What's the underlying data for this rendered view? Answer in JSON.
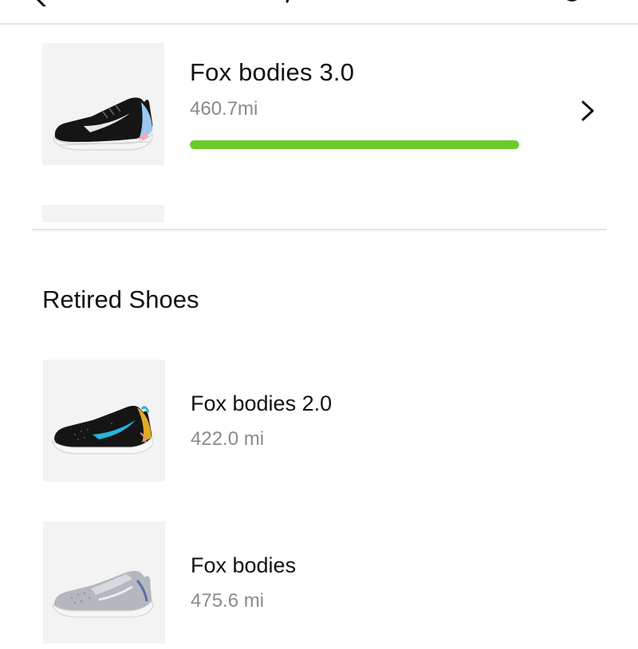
{
  "header": {
    "back_icon": "chevron-left-icon",
    "right_icon": "overflow-icon"
  },
  "active_shoe": {
    "name": "Fox bodies 3.0",
    "distance": "460.7mi",
    "progress_fraction": 1.0,
    "progress_color": "#6ccb2a",
    "image": "black running shoe with white swoosh",
    "open_icon": "chevron-right-icon"
  },
  "retired": {
    "title": "Retired Shoes",
    "items": [
      {
        "name": "Fox bodies 2.0",
        "distance": "422.0 mi",
        "image": "black shoe with blue swoosh and yellow heel"
      },
      {
        "name": "Fox bodies",
        "distance": "475.6 mi",
        "image": "grey knit running shoe"
      }
    ]
  },
  "colors": {
    "accent_green": "#6ccb2a",
    "divider": "#e3e3e3",
    "thumb_bg": "#f3f3f3",
    "secondary_text": "#8a8a8a"
  }
}
